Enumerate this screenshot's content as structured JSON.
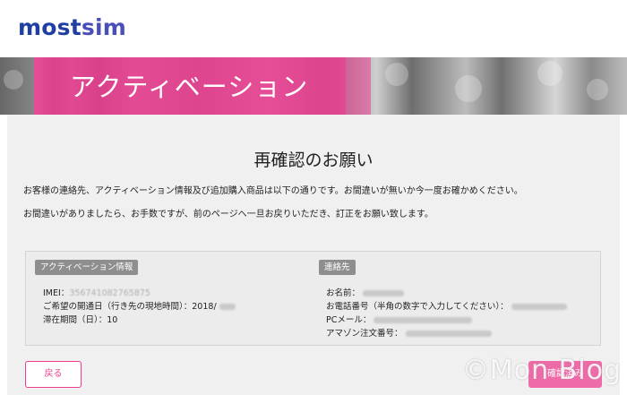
{
  "brand": {
    "logo_part1": "most",
    "logo_part2": "sim"
  },
  "banner": {
    "title": "アクティベーション"
  },
  "main": {
    "heading": "再確認のお願い",
    "note1": "お客様の連絡先、アクティベーション情報及び追加購入商品は以下の通りです。お間違いが無いか今一度お確かめください。",
    "note2": "お間違いがありましたら、お手数ですが、前のページへ一旦お戻りいただき、訂正をお願い致します。"
  },
  "activation": {
    "badge": "アクティベーション情報",
    "imei_label": "IMEI：",
    "imei_value": "356741082765875",
    "open_date_label": "ご希望の開通日（行き先の現地時間）：",
    "open_date_value": "2018/",
    "stay_label": "滞在期間（日）：",
    "stay_value": "10"
  },
  "contact": {
    "badge": "連絡先",
    "name_label": "お名前：",
    "phone_label": "お電話番号（半角の数字で入力してください）：",
    "email_label": "PCメール：",
    "amazon_label": "アマゾン注文番号："
  },
  "buttons": {
    "back": "戻る",
    "confirm": "確認済み"
  },
  "watermark": "©Mon Blog",
  "colors": {
    "accent": "#ec3d8e",
    "logo_blue": "#1f3fa3",
    "badge_gray": "#8e8e8e"
  }
}
